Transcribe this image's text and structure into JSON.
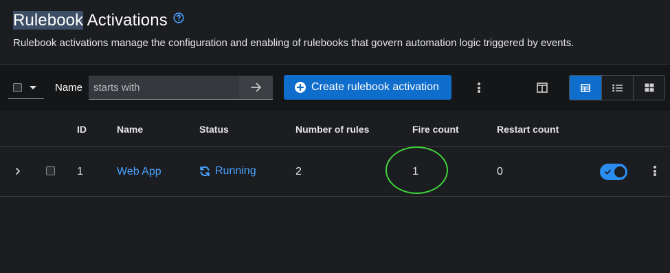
{
  "header": {
    "title_highlighted": "Rulebook",
    "title_rest": " Activations",
    "subtitle": "Rulebook activations manage the configuration and enabling of rulebooks that govern automation logic triggered by events."
  },
  "toolbar": {
    "filter_label": "Name",
    "filter_placeholder": "starts with",
    "create_label": "Create rulebook activation"
  },
  "table": {
    "columns": [
      "ID",
      "Name",
      "Status",
      "Number of rules",
      "Fire count",
      "Restart count"
    ],
    "rows": [
      {
        "id": "1",
        "name": "Web App",
        "status": "Running",
        "number_of_rules": "2",
        "fire_count": "1",
        "restart_count": "0",
        "enabled": true
      }
    ]
  },
  "icons": {
    "help": "help-circle-icon",
    "filter_submit": "arrow-right-icon",
    "create": "plus-circle-icon",
    "columns": "columns-icon",
    "view_table": "table-view-icon",
    "view_list": "list-view-icon",
    "view_cards": "cards-view-icon",
    "status": "sync-icon",
    "expand": "chevron-right-icon"
  },
  "colors": {
    "accent": "#0f6dcc",
    "link": "#4aa3ff",
    "highlight_annotation": "#3fd43a"
  }
}
